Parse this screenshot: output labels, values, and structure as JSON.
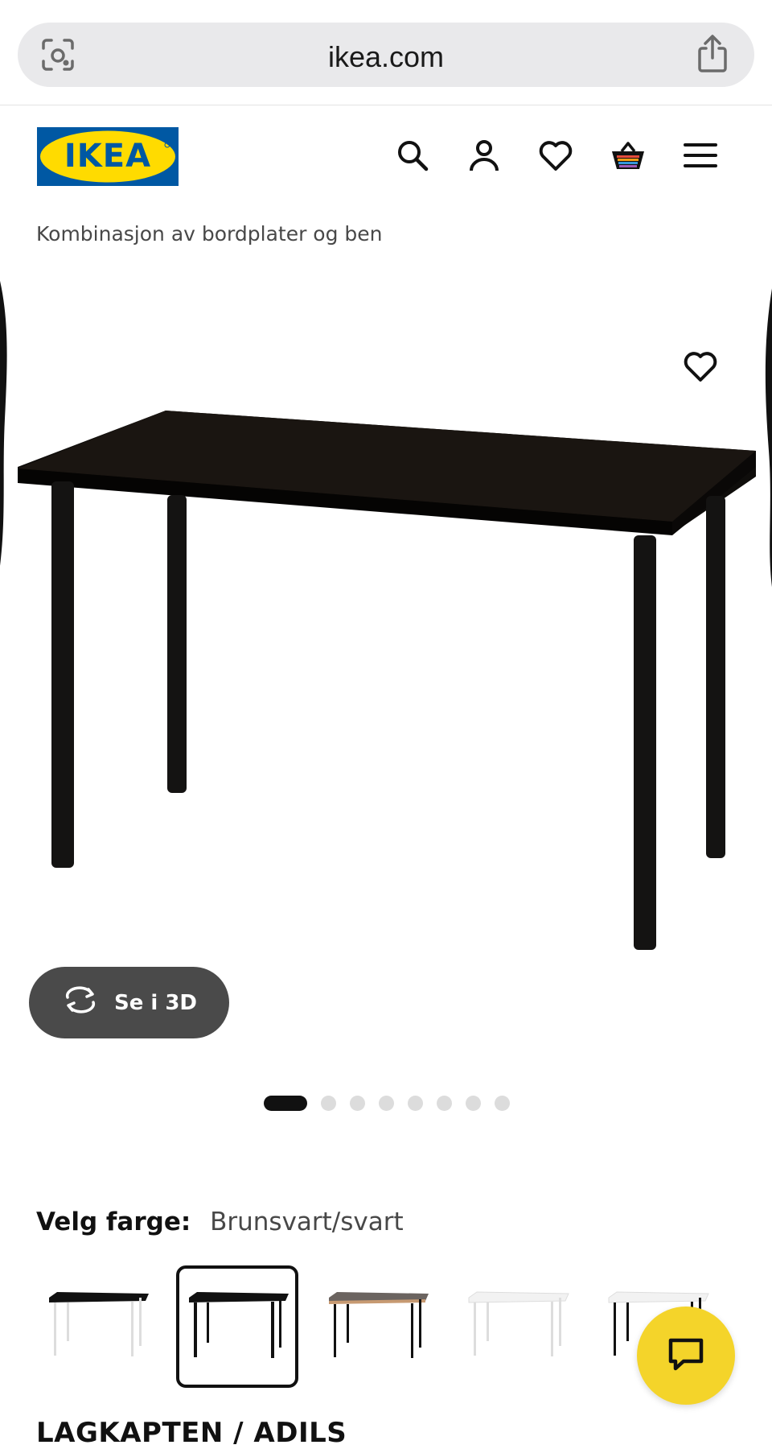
{
  "browser": {
    "url": "ikea.com"
  },
  "header": {
    "logo_text": "IKEA",
    "icons": [
      "search-icon",
      "account-icon",
      "wishlist-icon",
      "cart-icon",
      "menu-icon"
    ]
  },
  "breadcrumb": "Kombinasjon av bordplater og ben",
  "gallery": {
    "button_3d_label": "Se i 3D",
    "slide_count": 8,
    "active_slide": 1
  },
  "color_picker": {
    "label": "Velg farge:",
    "selected_value": "Brunsvart/svart",
    "options_visible": 5,
    "selected_index": 1
  },
  "product": {
    "name": "LAGKAPTEN / ADILS"
  },
  "colors": {
    "ikea_blue": "#0058a3",
    "ikea_yellow": "#ffdb00",
    "chat_yellow": "#f4d42a",
    "button_gray": "#4a4a4a"
  }
}
